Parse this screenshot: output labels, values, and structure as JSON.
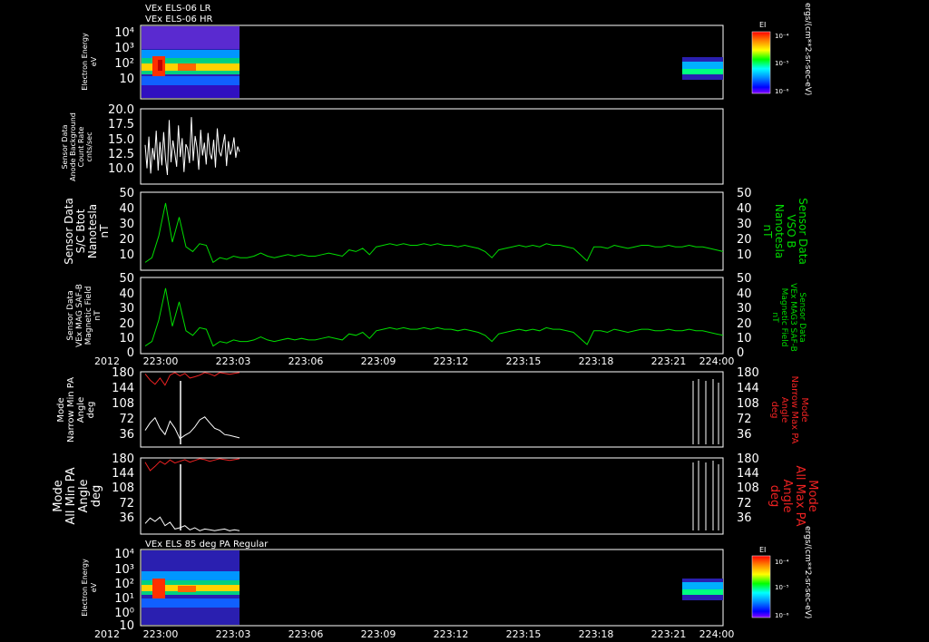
{
  "header": {
    "line1": "VEx ELS-06 LR",
    "line2": "VEx ELS-06 HR",
    "bottom_title": "VEx ELS 85 deg PA Regular"
  },
  "time_axis": {
    "year": "2012",
    "ticks": [
      "223:00",
      "223:03",
      "223:06",
      "223:09",
      "223:12",
      "223:15",
      "223:18",
      "223:21",
      "224:00"
    ]
  },
  "colorbar": {
    "label": "EI",
    "ticks": [
      "10⁻⁴",
      "10⁻⁵",
      "10⁻⁶"
    ],
    "unit": "ergs/(cm**2-sr-sec-eV)",
    "colors": [
      "#ff0000",
      "#ff8800",
      "#ffff00",
      "#00ff00",
      "#00ffff",
      "#0088ff",
      "#0000ff",
      "#8800ff"
    ]
  },
  "colors": {
    "green": "#00dd00",
    "red": "#ee2222",
    "white": "#ffffff"
  },
  "chart_data": [
    {
      "type": "heatmap",
      "ylabel": [
        "Electron Energy",
        "eV"
      ],
      "y_ticks": [
        "10⁴",
        "10³",
        "10²",
        "10"
      ]
    },
    {
      "type": "line",
      "ylabel": [
        "Sensor Data",
        "Anode Background",
        "Count Rate",
        "cnts/sec"
      ],
      "y_ticks": [
        "20.0",
        "17.5",
        "15.0",
        "12.5",
        "10.0"
      ],
      "ylim": [
        10,
        20
      ],
      "series": [
        {
          "color": "#ffffff",
          "values": [
            15.2,
            12.1,
            16.3,
            11.4,
            14.8,
            13.2,
            17.1,
            11.8,
            15.6,
            12.5,
            16.9,
            13.4,
            11.2,
            18.5,
            12.9,
            15.8,
            14.2,
            12.3,
            17.8,
            13.6,
            16.1,
            11.6,
            15.3,
            14.7,
            12.8,
            18.9,
            13.1,
            16.4,
            14.9,
            11.9,
            17.2,
            13.8,
            15.5,
            12.6,
            16.8,
            14.1,
            13.3,
            15.9,
            12.2,
            17.4,
            14.4,
            13.7,
            15.1,
            16.6,
            12.4,
            15.7,
            13.9,
            14.6,
            16.2,
            13.5,
            15.0,
            14.3
          ]
        }
      ]
    },
    {
      "type": "line",
      "ylabel": [
        "Sensor Data",
        "S/C Btot",
        "Nanotesla",
        "nT"
      ],
      "ylabel_right": [
        "Sensor Data",
        "VSO B",
        "Nanotesla",
        "nT"
      ],
      "y_ticks": [
        "50",
        "40",
        "30",
        "20",
        "10"
      ],
      "ylim": [
        0,
        50
      ],
      "series": [
        {
          "color": "#00dd00",
          "values": [
            5,
            8,
            22,
            43,
            18,
            34,
            15,
            12,
            17,
            16,
            5,
            8,
            7,
            9,
            8,
            8,
            9,
            11,
            9,
            8,
            9,
            10,
            9,
            10,
            9,
            9,
            10,
            11,
            10,
            9,
            13,
            12,
            14,
            10,
            15,
            16,
            17,
            16,
            17,
            16,
            16,
            17,
            16,
            17,
            16,
            16,
            15,
            16,
            15,
            14,
            12,
            8,
            13,
            14,
            15,
            16,
            15,
            16,
            15,
            17,
            16,
            16,
            15,
            14,
            10,
            6,
            15,
            15,
            14,
            16,
            15,
            14,
            15,
            16,
            16,
            15,
            15,
            16,
            15,
            15,
            16,
            15,
            15,
            14,
            13,
            12
          ]
        }
      ]
    },
    {
      "type": "line",
      "ylabel": [
        "Sensor Data",
        "VEx MAG SAF-B",
        "Magnetic Field",
        "nT"
      ],
      "ylabel_right": [
        "Sensor Data",
        "VEx MAG3 SAF-B",
        "Magnetic Field",
        "nT"
      ],
      "y_ticks": [
        "50",
        "40",
        "30",
        "20",
        "10",
        "0"
      ],
      "ylim": [
        0,
        50
      ],
      "series": [
        {
          "color": "#00dd00",
          "values": [
            5,
            8,
            22,
            43,
            18,
            34,
            15,
            12,
            17,
            16,
            5,
            8,
            7,
            9,
            8,
            8,
            9,
            11,
            9,
            8,
            9,
            10,
            9,
            10,
            9,
            9,
            10,
            11,
            10,
            9,
            13,
            12,
            14,
            10,
            15,
            16,
            17,
            16,
            17,
            16,
            16,
            17,
            16,
            17,
            16,
            16,
            15,
            16,
            15,
            14,
            12,
            8,
            13,
            14,
            15,
            16,
            15,
            16,
            15,
            17,
            16,
            16,
            15,
            14,
            10,
            6,
            15,
            15,
            14,
            16,
            15,
            14,
            15,
            16,
            16,
            15,
            15,
            16,
            15,
            15,
            16,
            15,
            15,
            14,
            13,
            12
          ]
        }
      ]
    },
    {
      "type": "line",
      "ylabel": [
        "Mode",
        "Narrow Min PA",
        "Angle",
        "deg"
      ],
      "ylabel_right": [
        "Mode",
        "Narrow Max PA",
        "Angle",
        "deg"
      ],
      "y_ticks": [
        "180",
        "144",
        "108",
        "72",
        "36"
      ],
      "ylim": [
        0,
        180
      ],
      "series": [
        {
          "color": "#ee2222",
          "values": [
            175,
            160,
            150,
            165,
            148,
            172,
            178,
            170,
            176,
            165,
            168,
            172,
            178,
            175,
            170,
            178,
            176,
            174,
            176,
            178
          ]
        },
        {
          "color": "#ffffff",
          "values": [
            40,
            58,
            70,
            45,
            30,
            62,
            45,
            20,
            28,
            35,
            48,
            65,
            72,
            58,
            45,
            40,
            30,
            28,
            25,
            22
          ]
        }
      ]
    },
    {
      "type": "line",
      "ylabel": [
        "Mode",
        "All Min PA",
        "Angle",
        "deg"
      ],
      "ylabel_right": [
        "Mode",
        "All Max PA",
        "Angle",
        "deg"
      ],
      "y_ticks": [
        "180",
        "144",
        "108",
        "72",
        "36"
      ],
      "ylim": [
        0,
        180
      ],
      "series": [
        {
          "color": "#ee2222",
          "values": [
            170,
            150,
            160,
            172,
            165,
            175,
            168,
            172,
            176,
            170,
            174,
            178,
            176,
            172,
            175,
            178,
            176,
            174,
            176,
            178
          ]
        },
        {
          "color": "#ffffff",
          "values": [
            25,
            38,
            30,
            40,
            20,
            28,
            12,
            15,
            20,
            10,
            15,
            8,
            12,
            10,
            8,
            10,
            12,
            8,
            10,
            8
          ]
        }
      ]
    },
    {
      "type": "heatmap",
      "ylabel": [
        "Electron Energy",
        "eV"
      ],
      "y_ticks": [
        "10⁴",
        "10³",
        "10²",
        "10¹",
        "10⁰",
        "10"
      ]
    }
  ]
}
